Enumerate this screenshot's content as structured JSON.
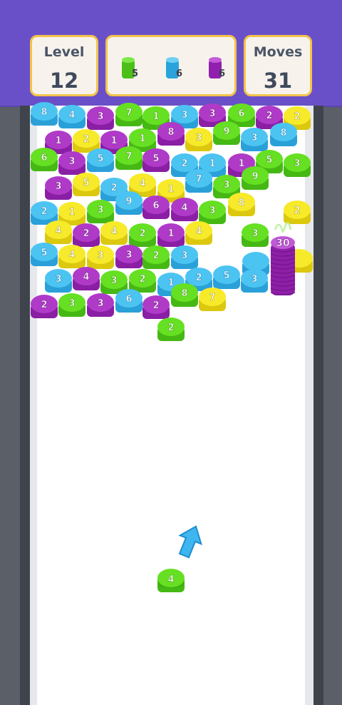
{
  "hud": {
    "level_label": "Level",
    "level_value": "12",
    "moves_label": "Moves",
    "moves_value": "31",
    "goals": [
      {
        "color": "green",
        "count": "5"
      },
      {
        "color": "blue",
        "count": "6"
      },
      {
        "color": "purple",
        "count": "6"
      }
    ]
  },
  "colors": {
    "green": "#5ed81c",
    "blue": "#3db8ec",
    "purple": "#a62fc0",
    "yellow": "#f5e61a",
    "topbar": "#6a50c8",
    "hud_border": "#f3c34a"
  },
  "board": {
    "chips": [
      {
        "c": "blue",
        "n": "8"
      },
      {
        "c": "blue",
        "n": "4"
      },
      {
        "c": "purple",
        "n": "3"
      },
      {
        "c": "green",
        "n": "7"
      },
      {
        "c": "green",
        "n": "1"
      },
      {
        "c": "blue",
        "n": "3"
      },
      {
        "c": "purple",
        "n": "3"
      },
      {
        "c": "green",
        "n": "6"
      },
      {
        "c": "purple",
        "n": "2"
      },
      {
        "c": "yellow",
        "n": "2"
      },
      {
        "c": "purple",
        "n": "1"
      },
      {
        "c": "yellow",
        "n": "2"
      },
      {
        "c": "purple",
        "n": "1"
      },
      {
        "c": "green",
        "n": "1"
      },
      {
        "c": "purple",
        "n": "8"
      },
      {
        "c": "yellow",
        "n": "3"
      },
      {
        "c": "green",
        "n": "9"
      },
      {
        "c": "blue",
        "n": "3"
      },
      {
        "c": "blue",
        "n": "8"
      },
      {
        "c": "green",
        "n": "6"
      },
      {
        "c": "purple",
        "n": "3"
      },
      {
        "c": "blue",
        "n": "5"
      },
      {
        "c": "green",
        "n": "7"
      },
      {
        "c": "purple",
        "n": "5"
      },
      {
        "c": "blue",
        "n": "2"
      },
      {
        "c": "blue",
        "n": "1"
      },
      {
        "c": "purple",
        "n": "1"
      },
      {
        "c": "green",
        "n": "5"
      },
      {
        "c": "green",
        "n": "3"
      },
      {
        "c": "purple",
        "n": "3"
      },
      {
        "c": "yellow",
        "n": "5"
      },
      {
        "c": "blue",
        "n": "2"
      },
      {
        "c": "yellow",
        "n": "4"
      },
      {
        "c": "yellow",
        "n": "1"
      },
      {
        "c": "blue",
        "n": "7"
      },
      {
        "c": "green",
        "n": "3"
      },
      {
        "c": "green",
        "n": "9"
      },
      {
        "c": "blue",
        "n": "2"
      },
      {
        "c": "yellow",
        "n": "1"
      },
      {
        "c": "green",
        "n": "3"
      },
      {
        "c": "blue",
        "n": "9"
      },
      {
        "c": "purple",
        "n": "6"
      },
      {
        "c": "purple",
        "n": "4"
      },
      {
        "c": "green",
        "n": "3"
      },
      {
        "c": "yellow",
        "n": "8"
      },
      {
        "c": "yellow",
        "n": "2"
      },
      {
        "c": "yellow",
        "n": "4"
      },
      {
        "c": "purple",
        "n": "2"
      },
      {
        "c": "yellow",
        "n": "4"
      },
      {
        "c": "green",
        "n": "2"
      },
      {
        "c": "purple",
        "n": "1"
      },
      {
        "c": "yellow",
        "n": "4"
      },
      {
        "c": "green",
        "n": "3"
      },
      {
        "c": "blue",
        "n": "5"
      },
      {
        "c": "yellow",
        "n": "4"
      },
      {
        "c": "yellow",
        "n": "3"
      },
      {
        "c": "purple",
        "n": "3"
      },
      {
        "c": "green",
        "n": "2"
      },
      {
        "c": "blue",
        "n": "3"
      },
      {
        "c": "blue",
        "n": ""
      },
      {
        "c": "yellow",
        "n": ""
      },
      {
        "c": "blue",
        "n": "3"
      },
      {
        "c": "purple",
        "n": "4"
      },
      {
        "c": "green",
        "n": "3"
      },
      {
        "c": "green",
        "n": "2"
      },
      {
        "c": "blue",
        "n": "1"
      },
      {
        "c": "blue",
        "n": "2"
      },
      {
        "c": "blue",
        "n": "5"
      },
      {
        "c": "blue",
        "n": "3"
      },
      {
        "c": "purple",
        "n": "2"
      },
      {
        "c": "green",
        "n": "3"
      },
      {
        "c": "purple",
        "n": "3"
      },
      {
        "c": "blue",
        "n": "6"
      },
      {
        "c": "purple",
        "n": "2"
      },
      {
        "c": "green",
        "n": "8"
      },
      {
        "c": "yellow",
        "n": "7"
      },
      {
        "c": "green",
        "n": "2"
      }
    ],
    "tall_stack": {
      "color": "purple",
      "count": "30"
    },
    "shooter": {
      "color": "green",
      "count": "4"
    }
  }
}
